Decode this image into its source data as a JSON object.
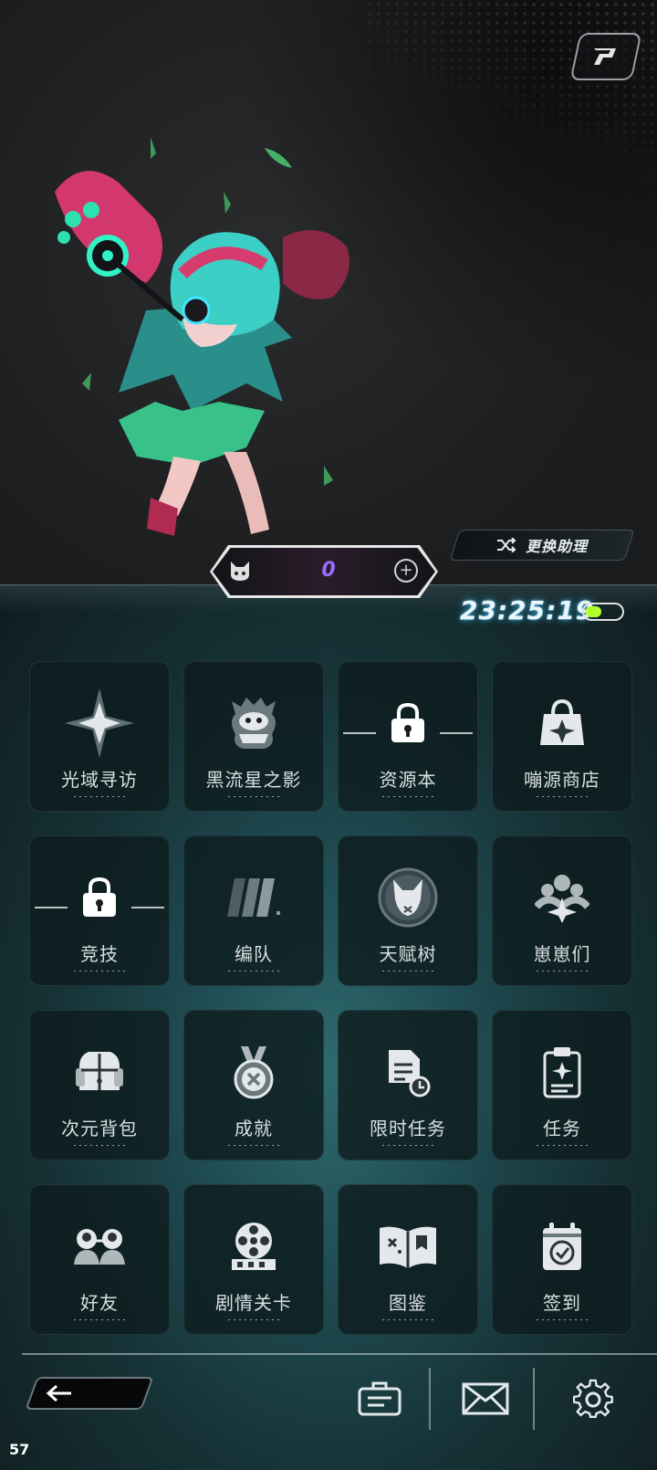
{
  "header": {
    "logo_icon": "game-logo-icon",
    "swap_assistant_label": "更换助理",
    "swap_icon": "shuffle-icon"
  },
  "currency": {
    "icon": "cat-head-icon",
    "value": "0",
    "add_icon": "plus-circle-icon"
  },
  "status": {
    "clock": "23:25:19",
    "battery_level": 0.45,
    "battery_color": "#b5ff29"
  },
  "menu": [
    {
      "label": "光域寻访",
      "icon": "compass-star-icon",
      "locked": false
    },
    {
      "label": "黑流星之影",
      "icon": "monster-icon",
      "locked": false
    },
    {
      "label": "资源本",
      "icon": "lock-icon",
      "locked": true
    },
    {
      "label": "嘣源商店",
      "icon": "shop-bag-icon",
      "locked": false
    },
    {
      "label": "竞技",
      "icon": "lock-icon",
      "locked": true
    },
    {
      "label": "编队",
      "icon": "team-cards-icon",
      "locked": false
    },
    {
      "label": "天赋树",
      "icon": "fox-emblem-icon",
      "locked": false
    },
    {
      "label": "崽崽们",
      "icon": "group-icon",
      "locked": false
    },
    {
      "label": "次元背包",
      "icon": "backpack-icon",
      "locked": false
    },
    {
      "label": "成就",
      "icon": "medal-icon",
      "locked": false
    },
    {
      "label": "限时任务",
      "icon": "timed-document-icon",
      "locked": false
    },
    {
      "label": "任务",
      "icon": "clipboard-icon",
      "locked": false
    },
    {
      "label": "好友",
      "icon": "friends-icon",
      "locked": false
    },
    {
      "label": "剧情关卡",
      "icon": "film-reel-icon",
      "locked": false
    },
    {
      "label": "图鉴",
      "icon": "open-book-icon",
      "locked": false
    },
    {
      "label": "签到",
      "icon": "calendar-check-icon",
      "locked": false
    }
  ],
  "bottom_bar": {
    "back_icon": "arrow-left-icon",
    "notice_icon": "notice-board-icon",
    "mail_icon": "mail-icon",
    "settings_icon": "gear-icon"
  },
  "fps": "57",
  "colors": {
    "accent_cyan": "#39a9d9",
    "currency_purple": "#9a6cff",
    "panel_teal": "#1f4c52"
  }
}
